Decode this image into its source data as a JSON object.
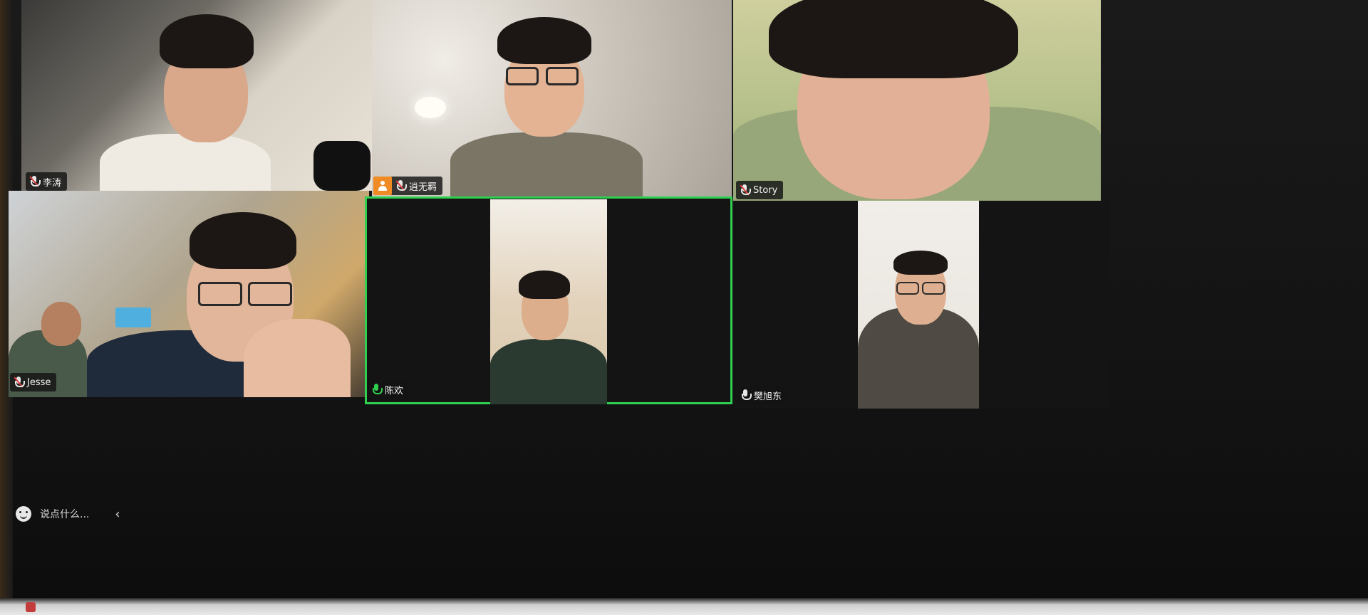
{
  "participants": [
    {
      "name": "李涛",
      "mic": "muted"
    },
    {
      "name": "逍无羁",
      "mic": "muted",
      "host": true
    },
    {
      "name": "Story",
      "mic": "muted"
    },
    {
      "name": "Jesse",
      "mic": "muted"
    },
    {
      "name": "陈欢",
      "mic": "active",
      "speaking": true
    },
    {
      "name": "樊旭东",
      "mic": "on"
    }
  ],
  "chat": {
    "placeholder": "说点什么..."
  },
  "colors": {
    "active_speaker_border": "#2fcf4f",
    "host_badge": "#f08a24",
    "mute_slash": "#e04040"
  }
}
